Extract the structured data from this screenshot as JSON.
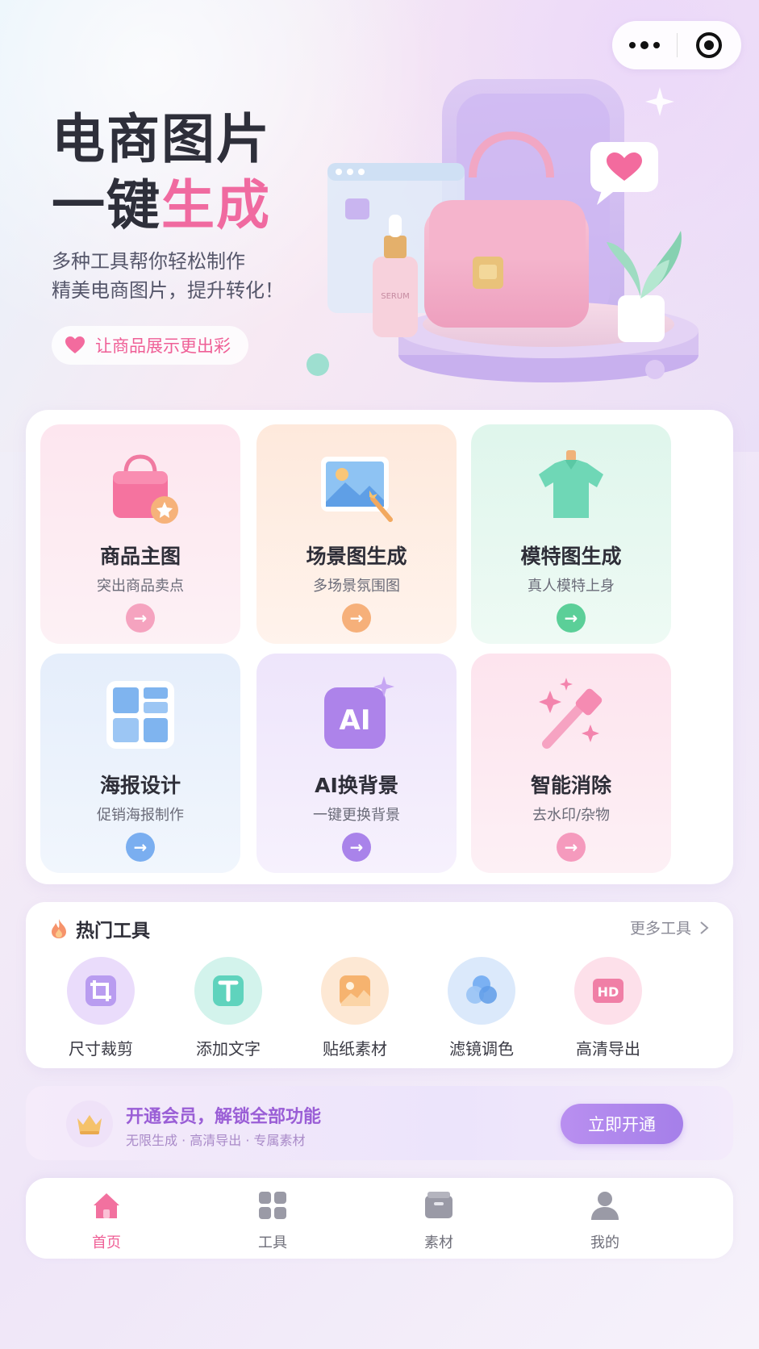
{
  "hero": {
    "title_line1": "电商图片",
    "title_line2_a": "一键",
    "title_line2_b": "生成",
    "subtitle_line1": "多种工具帮你轻松制作",
    "subtitle_line2": "精美电商图片，提升转化！",
    "pill_label": "让商品展示更出彩"
  },
  "features": [
    {
      "title": "商品主图",
      "subtitle": "突出商品卖点",
      "icon": "shopping-bag-icon",
      "accent": "#f47fa6"
    },
    {
      "title": "场景图生成",
      "subtitle": "多场景氛围图",
      "icon": "image-scene-icon",
      "accent": "#f6a869"
    },
    {
      "title": "模特图生成",
      "subtitle": "真人模特上身",
      "icon": "tshirt-icon",
      "accent": "#46c98d"
    },
    {
      "title": "海报设计",
      "subtitle": "促销海报制作",
      "icon": "poster-grid-icon",
      "accent": "#6aa6ec"
    },
    {
      "title": "AI换背景",
      "subtitle": "一键更换背景",
      "icon": "ai-icon",
      "accent": "#a97de6"
    },
    {
      "title": "智能消除",
      "subtitle": "去水印/杂物",
      "icon": "magic-wand-icon",
      "accent": "#f384ad"
    }
  ],
  "hot_tools": {
    "title": "热门工具",
    "more_label": "更多工具",
    "items": [
      {
        "label": "尺寸裁剪",
        "icon": "crop-icon",
        "color": "#b99cf0"
      },
      {
        "label": "添加文字",
        "icon": "text-icon",
        "color": "#5fd3bd"
      },
      {
        "label": "贴纸素材",
        "icon": "sticker-icon",
        "color": "#f6b36f"
      },
      {
        "label": "滤镜调色",
        "icon": "filter-icon",
        "color": "#76aef2"
      },
      {
        "label": "高清导出",
        "icon": "hd-icon",
        "color": "#f07fa6"
      }
    ]
  },
  "vip": {
    "title": "开通会员，解锁全部功能",
    "subtitle": "无限生成 · 高清导出 · 专属素材",
    "button": "立即开通"
  },
  "tabs": [
    {
      "label": "首页",
      "icon": "home-icon",
      "active": true
    },
    {
      "label": "工具",
      "icon": "grid-icon",
      "active": false
    },
    {
      "label": "素材",
      "icon": "box-icon",
      "active": false
    },
    {
      "label": "我的",
      "icon": "user-icon",
      "active": false
    }
  ]
}
